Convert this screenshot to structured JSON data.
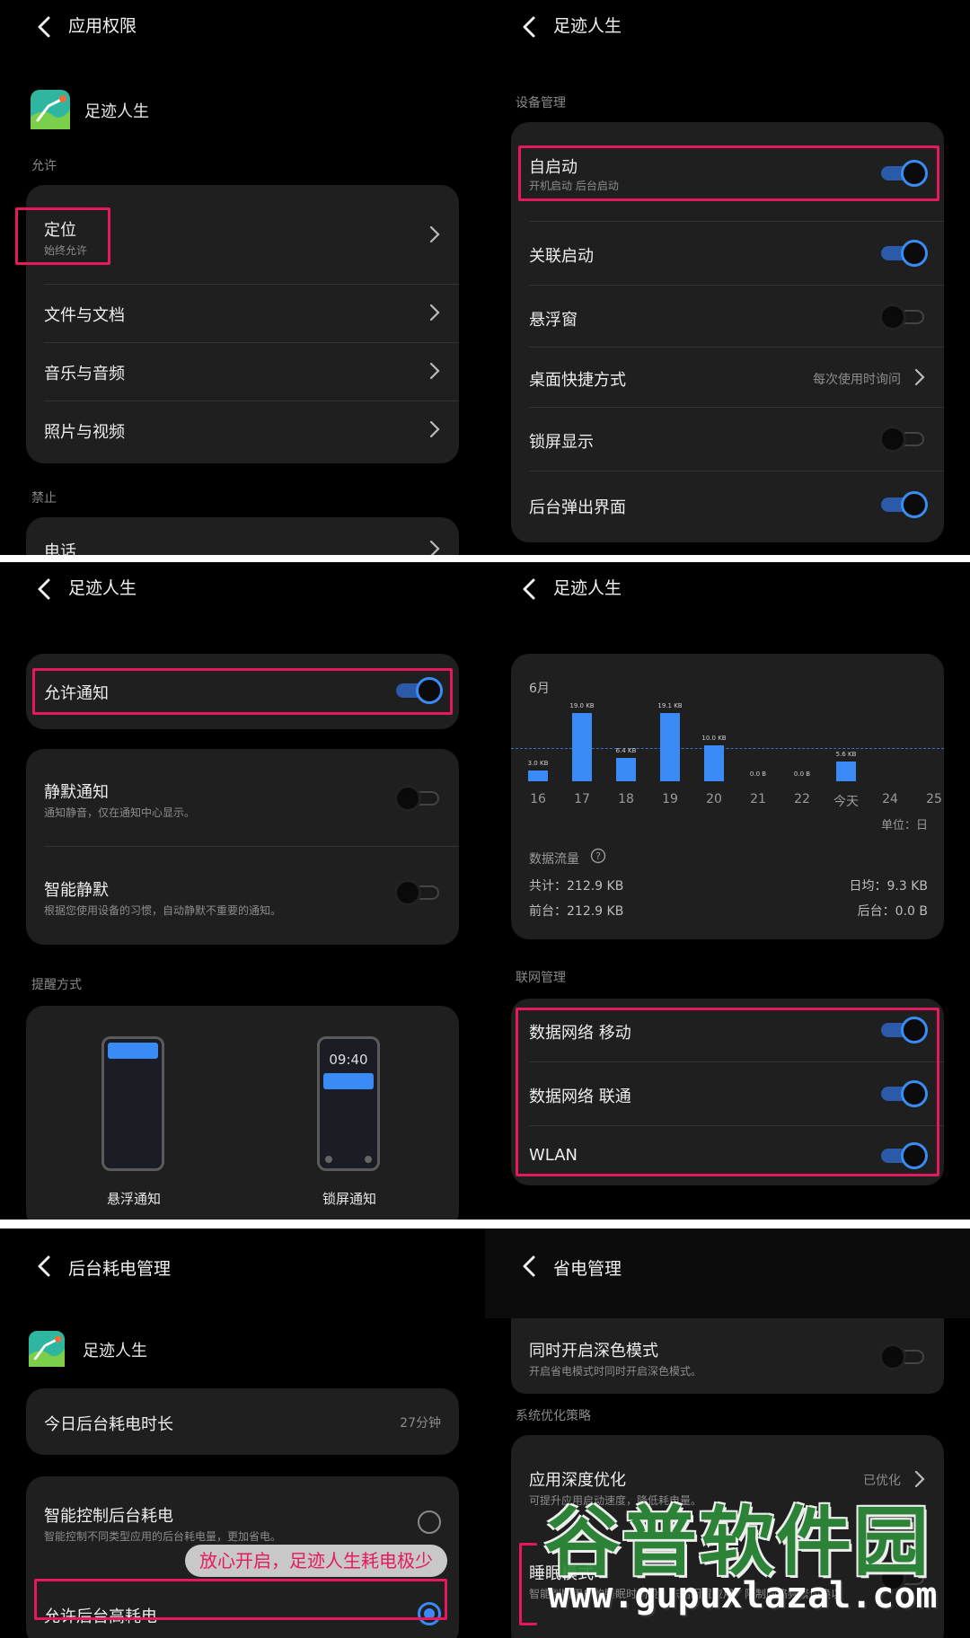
{
  "p1": {
    "title": "应用权限",
    "app_name": "足迹人生",
    "allow_label": "允许",
    "items": [
      {
        "title": "定位",
        "sub": "始终允许"
      },
      {
        "title": "文件与文档"
      },
      {
        "title": "音乐与音频"
      },
      {
        "title": "照片与视频"
      }
    ],
    "deny_label": "禁止",
    "deny_first": "电话"
  },
  "p2": {
    "title": "足迹人生",
    "section": "设备管理",
    "rows": [
      {
        "title": "自启动",
        "sub": "开机启动  后台启动",
        "on": true
      },
      {
        "title": "关联启动",
        "on": true
      },
      {
        "title": "悬浮窗",
        "on": false
      },
      {
        "title": "桌面快捷方式",
        "value": "每次使用时询问"
      },
      {
        "title": "锁屏显示",
        "on": false
      },
      {
        "title": "后台弹出界面",
        "on": true
      }
    ]
  },
  "p3": {
    "title": "足迹人生",
    "allow_notify": "允许通知",
    "silent": {
      "title": "静默通知",
      "sub": "通知静音，仅在通知中心显示。"
    },
    "smart": {
      "title": "智能静默",
      "sub": "根据您使用设备的习惯，自动静默不重要的通知。"
    },
    "remind_label": "提醒方式",
    "float_label": "悬浮通知",
    "lock_label": "锁屏通知",
    "lock_time": "09:40"
  },
  "p4": {
    "title": "足迹人生",
    "chart_data": {
      "type": "bar",
      "title": "6月",
      "categories": [
        "16",
        "17",
        "18",
        "19",
        "20",
        "21",
        "22",
        "今天",
        "24",
        "25"
      ],
      "values": [
        3.0,
        19.0,
        6.4,
        19.1,
        10.0,
        0.0,
        0.0,
        5.6,
        null,
        null
      ],
      "labels": [
        "3.0 KB",
        "19.0 KB",
        "6.4 KB",
        "19.1 KB",
        "10.0 KB",
        "0.0 B",
        "0.0 B",
        "5.6 KB",
        "",
        ""
      ],
      "average": 9.3,
      "unit_label": "单位：日",
      "ylim": [
        0,
        20
      ]
    },
    "traffic_label": "数据流量",
    "total": "共计：212.9 KB",
    "fore": "前台：212.9 KB",
    "avg": "日均：9.3 KB",
    "back": "后台：0.0 B",
    "net_section": "联网管理",
    "net_rows": [
      {
        "title": "数据网络 移动",
        "on": true
      },
      {
        "title": "数据网络 联通",
        "on": true
      },
      {
        "title": "WLAN",
        "on": true
      }
    ]
  },
  "p5": {
    "title": "后台耗电管理",
    "app_name": "足迹人生",
    "today_label": "今日后台耗电时长",
    "today_value": "27分钟",
    "smart_title": "智能控制后台耗电",
    "smart_sub": "智能控制不同类型应用的后台耗电量，更加省电。",
    "allow_high": "允许后台高耗电",
    "badge": "放心开启，足迹人生耗电极少"
  },
  "p6": {
    "title": "省电管理",
    "dark": {
      "title": "同时开启深色模式",
      "sub": "开启省电模式时同时开启深色模式。"
    },
    "section": "系统优化策略",
    "deep": {
      "title": "应用深度优化",
      "sub": "可提升应用启动速度，降低耗电量。",
      "value": "已优化"
    },
    "sleep": {
      "title": "睡眠模式",
      "sub": "智能判断用户的睡眠时间段，冻结闲置应用，限制网络频繁切换以"
    }
  },
  "watermark": {
    "brand": "谷普软件园",
    "url": "www.gupuxlazal.com"
  },
  "colors": {
    "accent": "#3a8bf5",
    "highlight": "#e6195e",
    "card": "#1f1f1f"
  }
}
